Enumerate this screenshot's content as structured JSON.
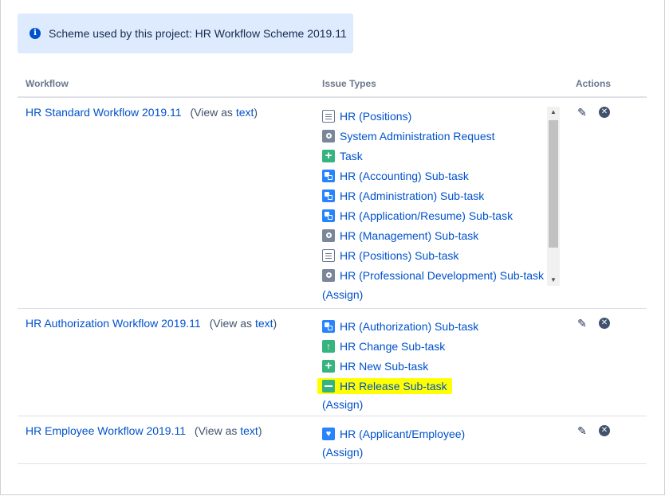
{
  "banner": {
    "icon": "info-icon",
    "text": "Scheme used by this project: HR Workflow Scheme 2019.11"
  },
  "table": {
    "headers": {
      "workflow": "Workflow",
      "issue_types": "Issue Types",
      "actions": "Actions"
    },
    "rows": [
      {
        "workflow": "HR Standard Workflow 2019.11",
        "view_prefix": "(View as ",
        "view_link": "text",
        "view_suffix": ")",
        "issue_types": [
          {
            "label": "HR (Positions)",
            "icon": "story-icon"
          },
          {
            "label": "System Administration Request",
            "icon": "gray-circle-icon"
          },
          {
            "label": "Task",
            "icon": "plus-icon"
          },
          {
            "label": "HR (Accounting) Sub-task",
            "icon": "subtask-icon"
          },
          {
            "label": "HR (Administration) Sub-task",
            "icon": "subtask-icon"
          },
          {
            "label": "HR (Application/Resume) Sub-task",
            "icon": "subtask-icon"
          },
          {
            "label": "HR (Management) Sub-task",
            "icon": "gray-circle-icon"
          },
          {
            "label": "HR (Positions) Sub-task",
            "icon": "story-icon"
          },
          {
            "label": "HR (Professional Development) Sub-task",
            "icon": "gray-circle-icon"
          }
        ],
        "assign": "(Assign)"
      },
      {
        "workflow": "HR Authorization Workflow 2019.11",
        "view_prefix": "(View as ",
        "view_link": "text",
        "view_suffix": ")",
        "issue_types": [
          {
            "label": "HR (Authorization) Sub-task",
            "icon": "subtask-icon"
          },
          {
            "label": "HR Change Sub-task",
            "icon": "arrow-up-icon"
          },
          {
            "label": "HR New Sub-task",
            "icon": "plus-icon"
          },
          {
            "label": "HR Release Sub-task",
            "icon": "minus-icon"
          }
        ],
        "assign": "(Assign)"
      },
      {
        "workflow": "HR Employee Workflow 2019.11",
        "view_prefix": "(View as ",
        "view_link": "text",
        "view_suffix": ")",
        "issue_types": [
          {
            "label": "HR (Applicant/Employee)",
            "icon": "heart-icon"
          }
        ],
        "assign": "(Assign)"
      }
    ]
  },
  "colors": {
    "link": "#0052cc",
    "banner_bg": "#deebff",
    "highlight": "#ffff00"
  }
}
